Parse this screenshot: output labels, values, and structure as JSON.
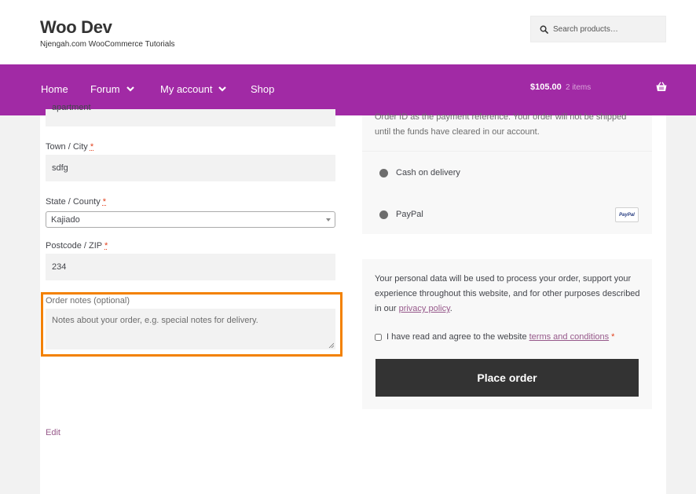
{
  "header": {
    "site_title": "Woo Dev",
    "tagline": "Njengah.com WooCommerce Tutorials",
    "search_placeholder": "Search products…"
  },
  "nav": {
    "items": [
      {
        "label": "Home",
        "has_dropdown": false
      },
      {
        "label": "Forum",
        "has_dropdown": true
      },
      {
        "label": "My account",
        "has_dropdown": true
      },
      {
        "label": "Shop",
        "has_dropdown": false
      }
    ],
    "cart_total": "$105.00",
    "cart_count": "2 items"
  },
  "form": {
    "address2_value": "apartment",
    "town_label": "Town / City",
    "town_value": "sdfg",
    "state_label": "State / County",
    "state_value": "Kajiado",
    "postcode_label": "Postcode / ZIP",
    "postcode_value": "234",
    "required_mark": "*",
    "notes_label": "Order notes (optional)",
    "notes_placeholder": "Notes about your order, e.g. special notes for delivery.",
    "edit_link": "Edit"
  },
  "payment": {
    "bank_desc": "Order ID as the payment reference. Your order will not be shipped until the funds have cleared in our account.",
    "options": [
      "Cash on delivery",
      "PayPal"
    ],
    "paypal_badge": "PayPal"
  },
  "order": {
    "privacy_text_1": "Your personal data will be used to process your order, support your experience throughout this website, and for other purposes described in our ",
    "privacy_link": "privacy policy",
    "privacy_text_2": ".",
    "terms_text": "I have read and agree to the website ",
    "terms_link": "terms and conditions",
    "terms_required": "*",
    "place_order_label": "Place order"
  },
  "colors": {
    "brand_purple": "#a12aa5",
    "highlight_orange": "#f38100",
    "button_dark": "#333333",
    "link": "#96588a"
  }
}
